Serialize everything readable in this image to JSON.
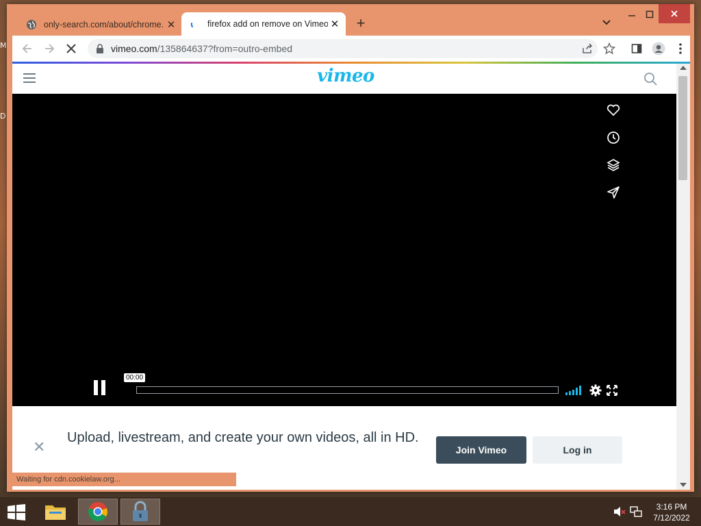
{
  "desktop": {
    "edge_letter_top": "M",
    "edge_letter_mid": "D"
  },
  "tabs": [
    {
      "title": "only-search.com/about/chrome.h",
      "icon": "globe-icon",
      "active": false
    },
    {
      "title": "firefox add on remove on Vimeo",
      "icon": "loading-spinner-icon",
      "active": true
    }
  ],
  "toolbar": {
    "url_host": "vimeo.com",
    "url_path": "/135864637?from=outro-embed"
  },
  "page": {
    "logo": "vimeo",
    "player": {
      "timestamp": "00:00",
      "progress": 0
    },
    "banner": {
      "text": "Upload, livestream, and create your own videos, all in HD.",
      "join_label": "Join Vimeo",
      "login_label": "Log in"
    },
    "status": "Waiting for cdn.cookielaw.org..."
  },
  "taskbar": {
    "time": "3:16 PM",
    "date": "7/12/2022"
  },
  "colors": {
    "window_frame": "#e8956d",
    "vimeo_blue": "#1ab7ea",
    "join_button": "#3b4d5a",
    "close_button": "#c3433f"
  }
}
